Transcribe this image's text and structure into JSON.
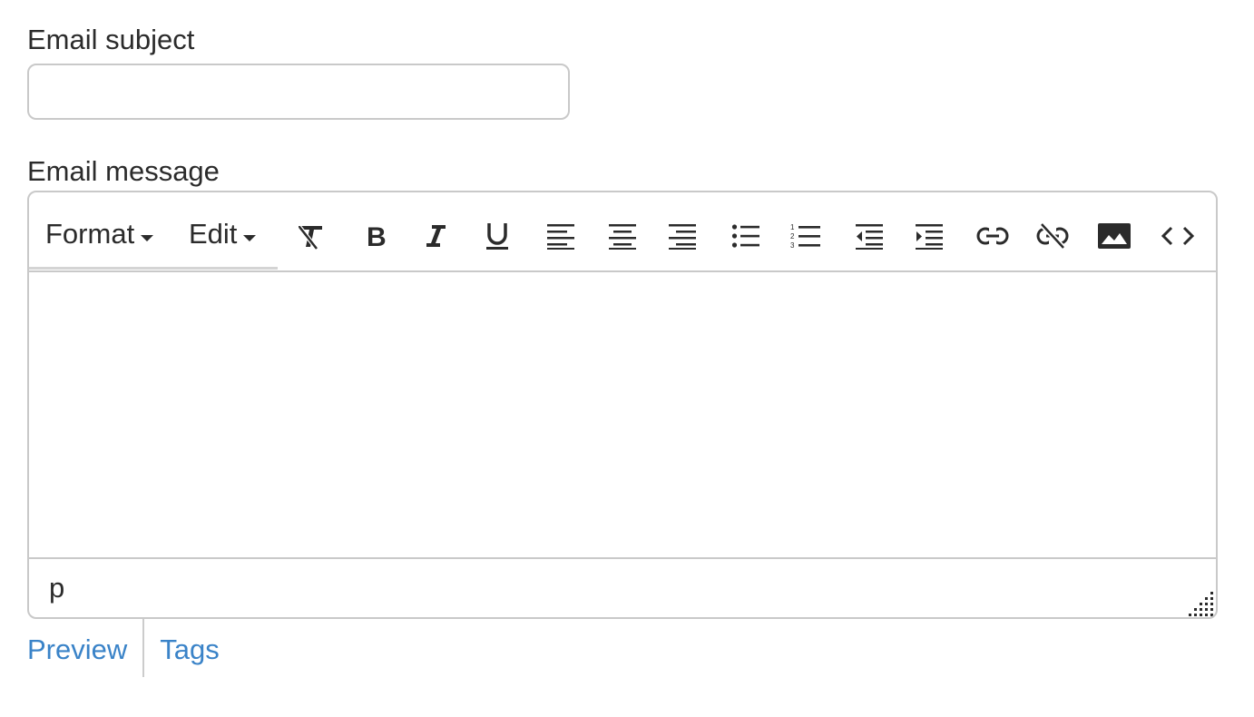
{
  "form": {
    "subject_label": "Email subject",
    "subject_value": "",
    "subject_placeholder": "",
    "message_label": "Email message"
  },
  "editor": {
    "menus": [
      {
        "label": "Format",
        "icon": "caret-down-icon"
      },
      {
        "label": "Edit",
        "icon": "caret-down-icon"
      }
    ],
    "toolbar_buttons": [
      {
        "name": "clear-formatting",
        "icon": "clear-format-icon"
      },
      {
        "name": "bold",
        "icon": "bold-icon"
      },
      {
        "name": "italic",
        "icon": "italic-icon"
      },
      {
        "name": "underline",
        "icon": "underline-icon"
      },
      {
        "name": "align-left",
        "icon": "align-left-icon"
      },
      {
        "name": "align-center",
        "icon": "align-center-icon"
      },
      {
        "name": "align-right",
        "icon": "align-right-icon"
      },
      {
        "name": "bullet-list",
        "icon": "bullet-list-icon"
      },
      {
        "name": "numbered-list",
        "icon": "numbered-list-icon"
      },
      {
        "name": "outdent",
        "icon": "outdent-icon"
      },
      {
        "name": "indent",
        "icon": "indent-icon"
      },
      {
        "name": "insert-link",
        "icon": "link-icon"
      },
      {
        "name": "remove-link",
        "icon": "unlink-icon"
      },
      {
        "name": "insert-image",
        "icon": "image-icon"
      },
      {
        "name": "source-code",
        "icon": "code-icon"
      }
    ],
    "content": "",
    "status_path": "p"
  },
  "links": {
    "preview": "Preview",
    "tags": "Tags"
  },
  "colors": {
    "link": "#3a83c8",
    "border": "#c9c9c9",
    "text": "#2b2b2b"
  }
}
